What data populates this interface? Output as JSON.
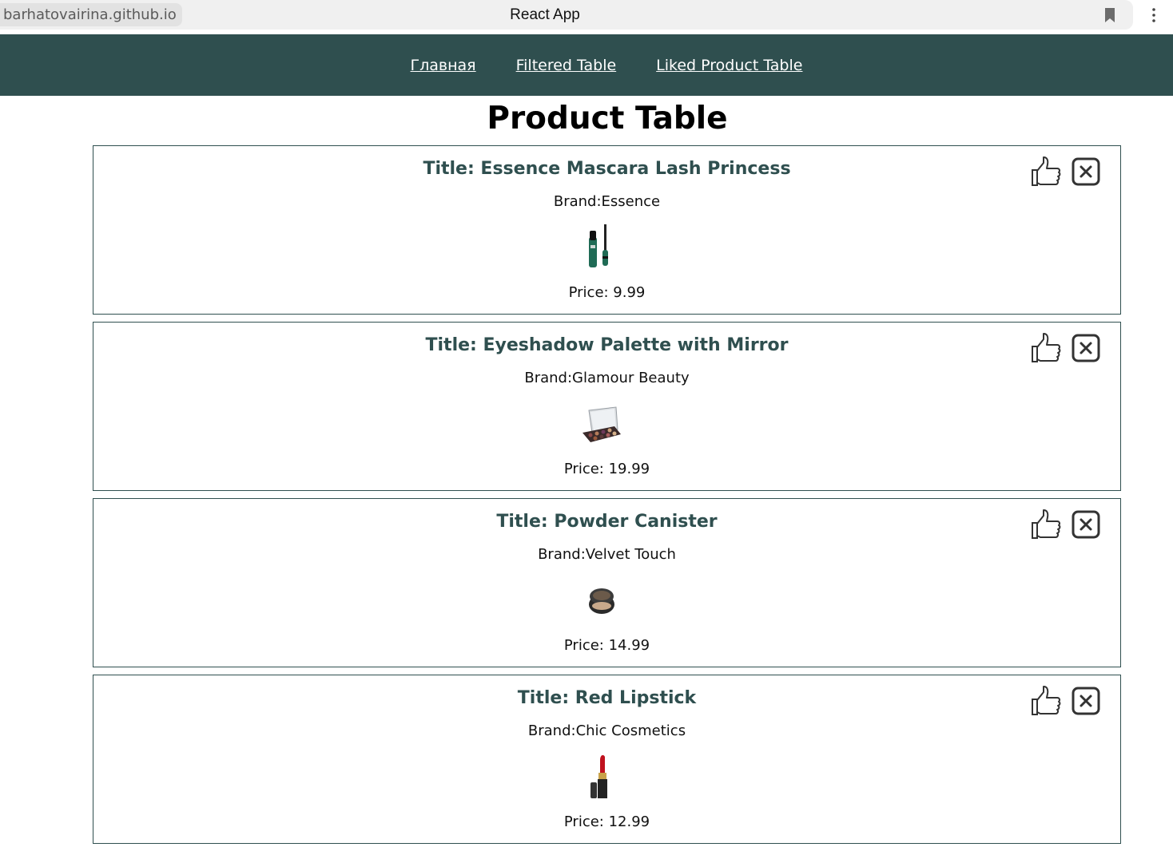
{
  "browser": {
    "url": "barhatovairina.github.io",
    "tab_title": "React App",
    "bookmark_icon": "bookmark-icon",
    "menu_icon": "more-vertical-icon"
  },
  "nav": {
    "links": [
      {
        "label": "Главная"
      },
      {
        "label": "Filtered Table"
      },
      {
        "label": "Liked Product Table"
      }
    ],
    "background": "#2f4f4f"
  },
  "page": {
    "heading": "Product Table"
  },
  "products": [
    {
      "title": "Title: Essence Mascara Lash Princess",
      "brand": "Brand:Essence",
      "price": "Price: 9.99",
      "image_icon": "mascara-image"
    },
    {
      "title": "Title: Eyeshadow Palette with Mirror",
      "brand": "Brand:Glamour Beauty",
      "price": "Price: 19.99",
      "image_icon": "eyeshadow-palette-image"
    },
    {
      "title": "Title: Powder Canister",
      "brand": "Brand:Velvet Touch",
      "price": "Price: 14.99",
      "image_icon": "powder-canister-image"
    },
    {
      "title": "Title: Red Lipstick",
      "brand": "Brand:Chic Cosmetics",
      "price": "Price: 12.99",
      "image_icon": "lipstick-image"
    }
  ],
  "actions": {
    "like_icon": "thumbs-up-icon",
    "remove_icon": "close-square-icon"
  },
  "colors": {
    "accent": "#2f4f4f",
    "text": "#111111"
  }
}
